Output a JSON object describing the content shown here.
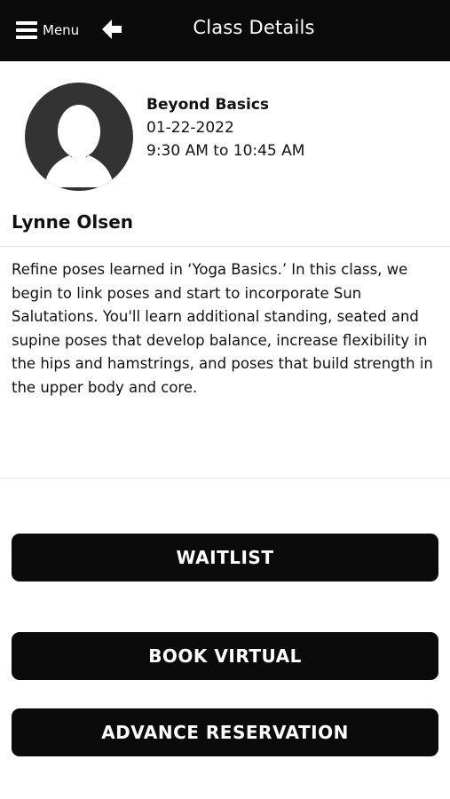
{
  "header": {
    "menu_label": "Menu",
    "title": "Class Details"
  },
  "class_info": {
    "name": "Beyond Basics",
    "date": "01-22-2022",
    "time": "9:30 AM to 10:45 AM",
    "instructor": "Lynne Olsen",
    "description": "Refine poses learned in ‘Yoga Basics.’  In this class, we begin to link poses and start to incorporate Sun Salutations.  You'll learn additional standing, seated and supine poses that develop balance, increase flexibility in the hips and hamstrings, and poses that build strength in the upper body and core."
  },
  "actions": {
    "waitlist": "WAITLIST",
    "book_virtual": "BOOK VIRTUAL",
    "advance_reservation": "ADVANCE RESERVATION"
  },
  "icons": {
    "menu": "hamburger-icon",
    "back": "arrow-left-icon",
    "avatar": "user-silhouette-icon"
  },
  "colors": {
    "header_bg": "#0b0b0b",
    "button_bg": "#0b0b0b",
    "avatar_bg": "#333333"
  }
}
